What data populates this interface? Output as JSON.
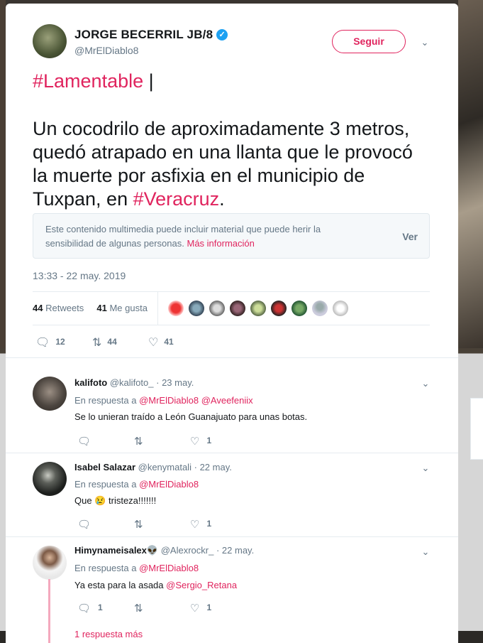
{
  "tweet": {
    "author_name": "JORGE BECERRIL JB/8",
    "verified_icon": "verified-badge-icon",
    "handle": "@MrElDiablo8",
    "follow_label": "Seguir",
    "hashtag_line": "#Lamentable",
    "cursor": "|",
    "body_line1": "Un cocodrilo de aproximadamente 3 metros,",
    "body_line2": "quedó atrapado en una llanta que le provocó",
    "body_line3": "la muerte por asfixia en el municipio de",
    "body_line4_prefix": "Tuxpan, en ",
    "body_line4_hashtag": "#Veracruz",
    "body_line4_suffix": ".",
    "sensitive_text": "Este contenido multimedia puede incluir material que puede herir la sensibilidad de algunas personas.",
    "sensitive_link": "Más información",
    "sensitive_view": "Ver",
    "timestamp": "13:33 - 22 may. 2019",
    "retweets_count": "44",
    "retweets_label": "Retweets",
    "likes_count": "41",
    "likes_label": "Me gusta",
    "reply_count": "12",
    "retweet_count_action": "44",
    "like_count_action": "41"
  },
  "replies": [
    {
      "name": "kalifoto",
      "handle": "@kalifoto_",
      "date": "23 may.",
      "in_reply_prefix": "En respuesta a",
      "mention1": "@MrElDiablo8",
      "mention2": "@Aveefeniix",
      "text": "Se lo unieran traído a León Guanajuato para unas botas.",
      "likes": "1"
    },
    {
      "name": "Isabel Salazar",
      "handle": "@kenymatali",
      "date": "22 may.",
      "in_reply_prefix": "En respuesta a",
      "mention1": "@MrElDiablo8",
      "text_prefix": "Que",
      "emoji": "😢",
      "text_suffix": "tristeza!!!!!!!",
      "likes": "1"
    },
    {
      "name": "Himynameisalex",
      "name_emoji": "👽",
      "handle": "@Alexrockr_",
      "date": "22 may.",
      "in_reply_prefix": "En respuesta a",
      "mention1": "@MrElDiablo8",
      "text_prefix": "Ya esta para la asada",
      "mention_text": "@Sergio_Retana",
      "replies": "1",
      "likes": "1",
      "more_replies": "1 respuesta más"
    }
  ],
  "colors": {
    "accent": "#e0245e",
    "muted": "#657786",
    "verified": "#1da1f2"
  }
}
